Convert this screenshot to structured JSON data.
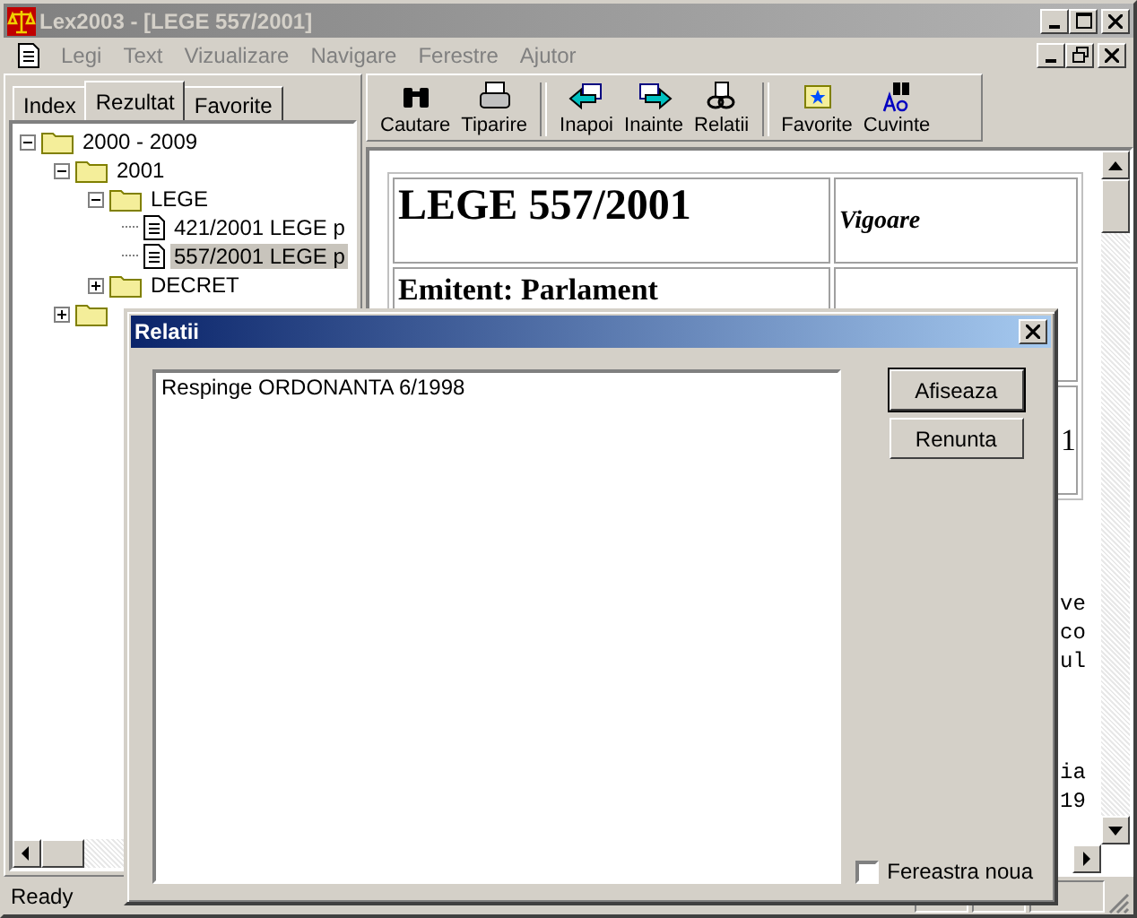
{
  "window": {
    "title": "Lex2003 - [LEGE 557/2001]"
  },
  "menu": [
    {
      "label": "Legi",
      "disabled": true
    },
    {
      "label": "Text",
      "disabled": true
    },
    {
      "label": "Vizualizare",
      "disabled": true
    },
    {
      "label": "Navigare",
      "disabled": true
    },
    {
      "label": "Ferestre",
      "disabled": true
    },
    {
      "label": "Ajutor",
      "disabled": true
    }
  ],
  "tabs": [
    {
      "label": "Index",
      "selected": false
    },
    {
      "label": "Rezultat",
      "selected": true
    },
    {
      "label": "Favorite",
      "selected": false
    }
  ],
  "tree": [
    {
      "kind": "folder",
      "label": "2000 - 2009",
      "expanded": true,
      "selected": false,
      "children": [
        {
          "kind": "folder",
          "label": "2001",
          "expanded": true,
          "selected": false,
          "children": [
            {
              "kind": "folder",
              "label": "LEGE",
              "expanded": true,
              "selected": false,
              "children": [
                {
                  "kind": "document",
                  "label": "421/2001 LEGE p",
                  "selected": false
                },
                {
                  "kind": "document",
                  "label": "557/2001 LEGE p",
                  "selected": true
                }
              ]
            },
            {
              "kind": "folder",
              "label": "DECRET",
              "expanded": false,
              "selected": false
            }
          ]
        },
        {
          "kind": "folder",
          "expanded": false,
          "selected": false
        }
      ]
    }
  ],
  "toolbar": [
    [
      {
        "label": "Cautare"
      },
      {
        "label": "Tiparire"
      }
    ],
    [
      {
        "label": "Inapoi"
      },
      {
        "label": "Inainte"
      },
      {
        "label": "Relatii"
      }
    ],
    [
      {
        "label": "Favorite"
      },
      {
        "label": "Cuvinte"
      }
    ]
  ],
  "document": {
    "table": [
      {
        "cells": [
          "LEGE 557/2001",
          "Vigoare"
        ]
      },
      {
        "cells": [
          "Emitent: Parlament",
          null
        ]
      },
      {
        "cells": [
          null,
          "1"
        ]
      }
    ],
    "paragraphs": [
      [
        "ve",
        "co",
        "ul"
      ],
      [
        "ia",
        "19"
      ]
    ]
  },
  "dialog": {
    "title": "Relatii",
    "items": [
      {
        "label": "Respinge ORDONANTA 6/1998",
        "selected": false
      }
    ],
    "buttons": [
      {
        "label": "Afiseaza",
        "default": true
      },
      {
        "label": "Renunta",
        "default": false
      }
    ],
    "checkbox": {
      "label": "Fereastra noua",
      "checked": false
    }
  },
  "status_bar": {
    "text": "Ready"
  }
}
